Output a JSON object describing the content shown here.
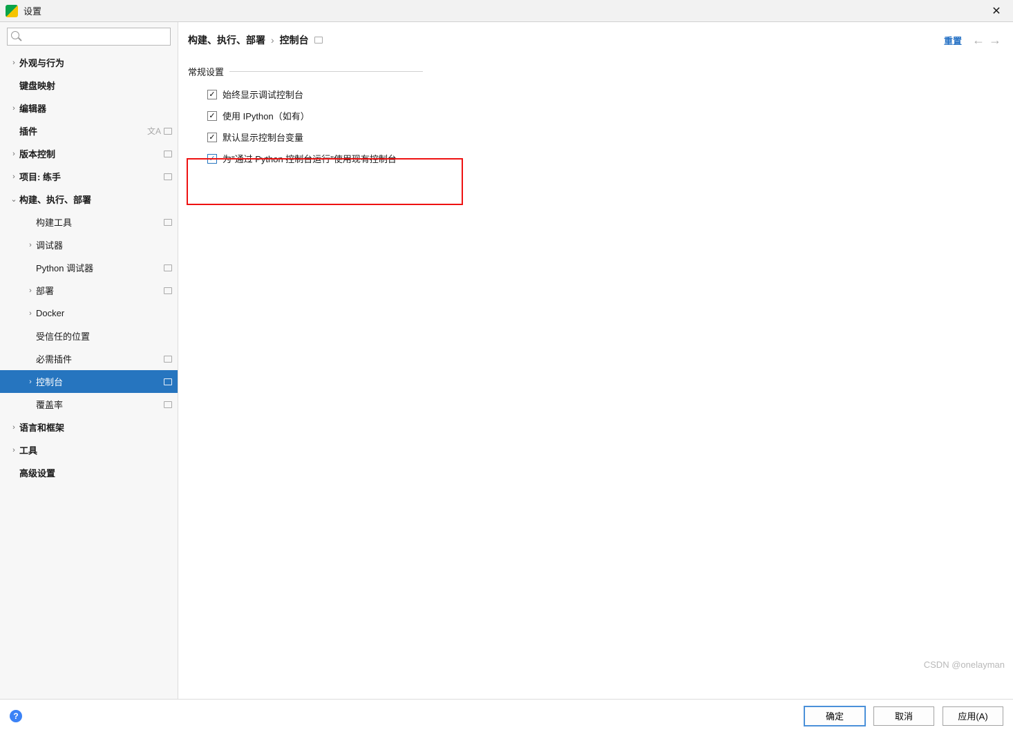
{
  "window": {
    "title": "设置"
  },
  "sidebar": {
    "search_placeholder": "",
    "items": [
      {
        "label": "外观与行为",
        "bold": true,
        "arrow": ">",
        "indent": 1
      },
      {
        "label": "键盘映射",
        "bold": true,
        "arrow": "",
        "indent": 1
      },
      {
        "label": "编辑器",
        "bold": true,
        "arrow": ">",
        "indent": 1
      },
      {
        "label": "插件",
        "bold": true,
        "arrow": "",
        "indent": 1,
        "tag": "lang+box"
      },
      {
        "label": "版本控制",
        "bold": true,
        "arrow": ">",
        "indent": 1,
        "tag": "box"
      },
      {
        "label": "项目: 练手",
        "bold": true,
        "arrow": ">",
        "indent": 1,
        "tag": "box"
      },
      {
        "label": "构建、执行、部署",
        "bold": true,
        "arrow": "v",
        "indent": 1
      },
      {
        "label": "构建工具",
        "bold": false,
        "arrow": "",
        "indent": 2,
        "tag": "box"
      },
      {
        "label": "调试器",
        "bold": false,
        "arrow": ">",
        "indent": 2
      },
      {
        "label": "Python 调试器",
        "bold": false,
        "arrow": "",
        "indent": 2,
        "tag": "box"
      },
      {
        "label": "部署",
        "bold": false,
        "arrow": ">",
        "indent": 2,
        "tag": "box"
      },
      {
        "label": "Docker",
        "bold": false,
        "arrow": ">",
        "indent": 2
      },
      {
        "label": "受信任的位置",
        "bold": false,
        "arrow": "",
        "indent": 2
      },
      {
        "label": "必需插件",
        "bold": false,
        "arrow": "",
        "indent": 2,
        "tag": "box"
      },
      {
        "label": "控制台",
        "bold": false,
        "arrow": ">",
        "indent": 2,
        "tag": "box",
        "selected": true
      },
      {
        "label": "覆盖率",
        "bold": false,
        "arrow": "",
        "indent": 2,
        "tag": "box"
      },
      {
        "label": "语言和框架",
        "bold": true,
        "arrow": ">",
        "indent": 1
      },
      {
        "label": "工具",
        "bold": true,
        "arrow": ">",
        "indent": 1
      },
      {
        "label": "高级设置",
        "bold": true,
        "arrow": "",
        "indent": 1
      }
    ]
  },
  "breadcrumb": {
    "root": "构建、执行、部署",
    "leaf": "控制台"
  },
  "actions": {
    "reset": "重置"
  },
  "section": {
    "title": "常规设置"
  },
  "checks": [
    {
      "label": "始终显示调试控制台",
      "checked": true,
      "blue": false
    },
    {
      "label": "使用 IPython（如有）",
      "checked": true,
      "blue": false
    },
    {
      "label": "默认显示控制台变量",
      "checked": true,
      "blue": false
    },
    {
      "label": "为\"通过 Python 控制台运行\"使用现有控制台",
      "checked": true,
      "blue": true
    }
  ],
  "buttons": {
    "ok": "确定",
    "cancel": "取消",
    "apply": "应用(A)"
  },
  "watermark": "CSDN @onelayman"
}
